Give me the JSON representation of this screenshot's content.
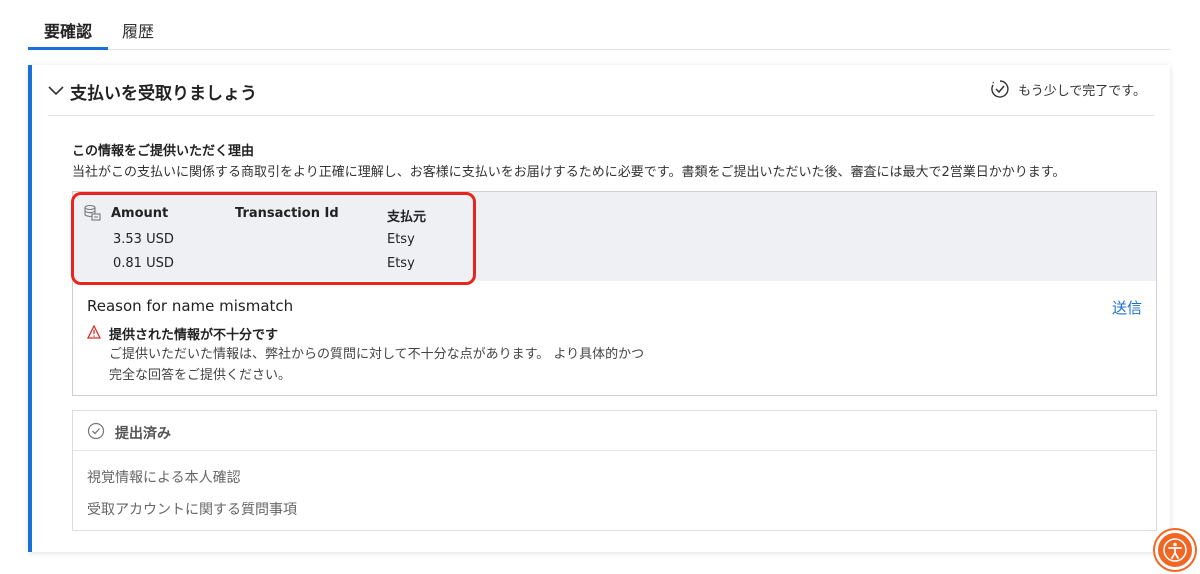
{
  "tabs": [
    {
      "label": "要確認",
      "active": true
    },
    {
      "label": "履歴",
      "active": false
    }
  ],
  "card": {
    "title": "支払いを受取りましょう",
    "progress_text": "もう少しで完了です。",
    "reason_title": "この情報をご提供いただく理由",
    "reason_desc": "当社がこの支払いに関係する商取引をより正確に理解し、お客様に支払いをお届けするために必要です。書類をご提出いただいた後、審査には最大で2営業日かかります。"
  },
  "transactions": {
    "headers": {
      "amount": "Amount",
      "transaction_id": "Transaction Id",
      "payer": "支払元"
    },
    "rows": [
      {
        "amount": "3.53 USD",
        "transaction_id": "",
        "payer": "Etsy"
      },
      {
        "amount": "0.81 USD",
        "transaction_id": "",
        "payer": "Etsy"
      }
    ]
  },
  "mismatch": {
    "label": "Reason for name mismatch",
    "send_label": "送信",
    "warning_title": "提供された情報が不十分です",
    "warning_line1": "ご提供いただいた情報は、弊社からの質問に対して不十分な点があります。 より具体的かつ",
    "warning_line2": "完全な回答をご提供ください。"
  },
  "submitted": {
    "title": "提出済み",
    "items": [
      "視覚情報による本人確認",
      "受取アカウントに関する質問事項"
    ]
  },
  "colors": {
    "accent": "#1a6fd8",
    "highlight": "#e8251c",
    "warning": "#d9302c",
    "a11y_button": "#f26522"
  },
  "icons": {
    "chevron": "chevron-down-icon",
    "progress": "clock-check-icon",
    "table": "database-icon",
    "warning": "warning-triangle-icon",
    "submitted": "check-circle-icon",
    "accessibility": "accessibility-icon"
  }
}
